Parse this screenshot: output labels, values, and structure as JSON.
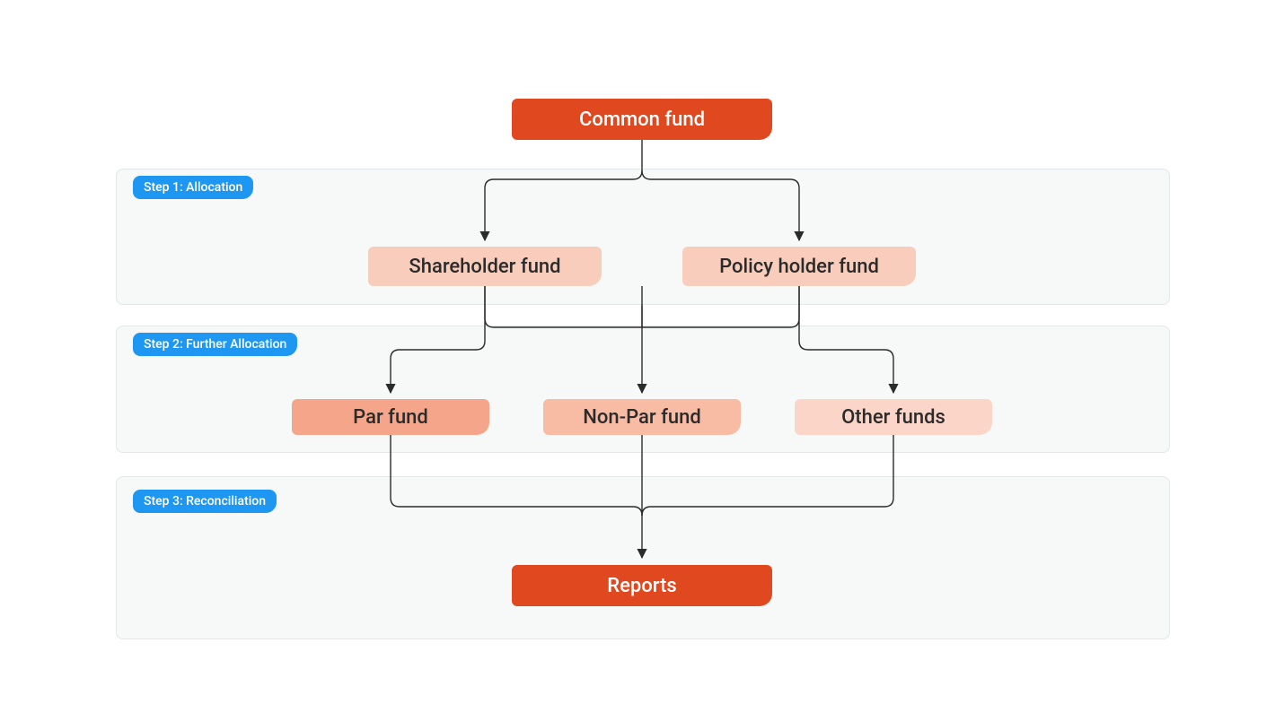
{
  "colors": {
    "accent": "#e0481f",
    "tag": "#1e97f3",
    "panel_bg": "#f7f8f8",
    "panel_border": "#e4e6e7"
  },
  "nodes": {
    "common_fund": "Common fund",
    "shareholder_fund": "Shareholder fund",
    "policy_holder_fund": "Policy holder fund",
    "par_fund": "Par fund",
    "non_par_fund": "Non-Par fund",
    "other_funds": "Other funds",
    "reports": "Reports"
  },
  "steps": {
    "step1": "Step 1: Allocation",
    "step2": "Step 2: Further Allocation",
    "step3": "Step 3: Reconciliation"
  }
}
